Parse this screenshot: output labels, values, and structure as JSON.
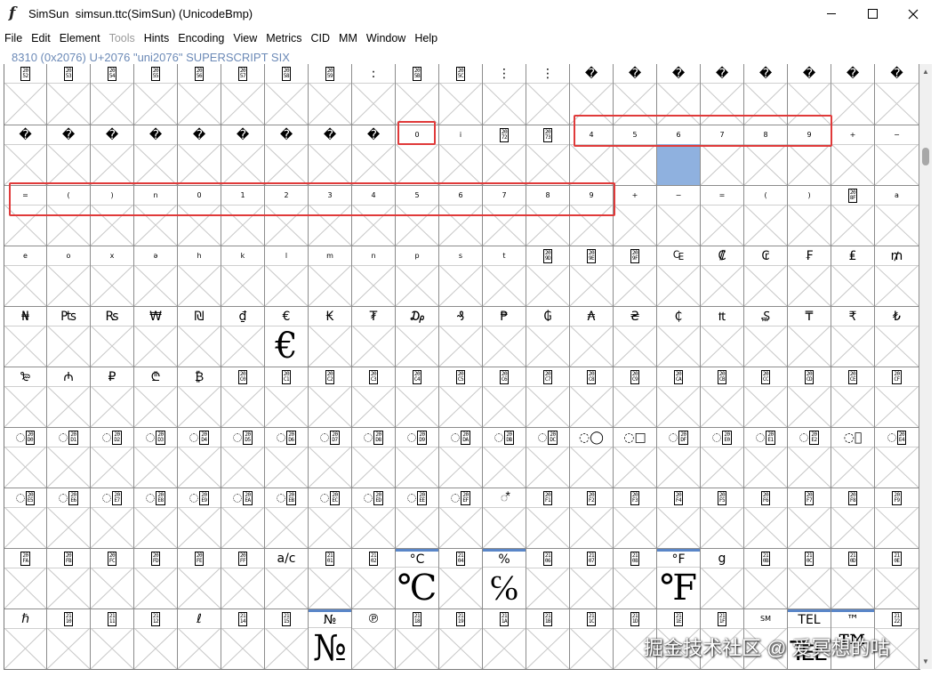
{
  "window": {
    "app_icon": "f",
    "title": "SimSun  simsun.ttc(SimSun) (UnicodeBmp)",
    "controls": [
      "minimize",
      "maximize",
      "close"
    ]
  },
  "menu": [
    "File",
    "Edit",
    "Element",
    "Tools",
    "Hints",
    "Encoding",
    "View",
    "Metrics",
    "CID",
    "MM",
    "Window",
    "Help"
  ],
  "menu_disabled": [
    "Tools"
  ],
  "info_line": "8310 (0x2076) U+2076 \"uni2076\" SUPERSCRIPT SIX",
  "watermark": "掘金技术社区 @ 爱冥想的咕",
  "rows": [
    [
      {
        "l": "hex:2052"
      },
      {
        "l": "hex:2053"
      },
      {
        "l": "hex:2054"
      },
      {
        "l": "hex:2055"
      },
      {
        "l": "hex:2056"
      },
      {
        "l": "hex:2057"
      },
      {
        "l": "hex:2058"
      },
      {
        "l": "hex:2059"
      },
      {
        "l": ":"
      },
      {
        "l": "hex:205B"
      },
      {
        "l": "hex:205C"
      },
      {
        "l": "⋮"
      },
      {
        "l": "⋮"
      },
      {
        "l": "�"
      },
      {
        "l": "�"
      },
      {
        "l": "�"
      },
      {
        "l": "�"
      },
      {
        "l": "�"
      },
      {
        "l": "�"
      },
      {
        "l": "�"
      },
      {
        "l": "�"
      }
    ],
    [
      {
        "l": "�"
      },
      {
        "l": "�"
      },
      {
        "l": "�"
      },
      {
        "l": "�"
      },
      {
        "l": "�"
      },
      {
        "l": "�"
      },
      {
        "l": "�"
      },
      {
        "l": "�"
      },
      {
        "l": "�"
      },
      {
        "l": "0",
        "t": 1
      },
      {
        "l": "i",
        "t": 1
      },
      {
        "l": "hex:2072"
      },
      {
        "l": "hex:2073"
      },
      {
        "l": "4",
        "t": 1
      },
      {
        "l": "5",
        "t": 1
      },
      {
        "l": "6",
        "t": 1,
        "sel": 1
      },
      {
        "l": "7",
        "t": 1
      },
      {
        "l": "8",
        "t": 1
      },
      {
        "l": "9",
        "t": 1
      },
      {
        "l": "+",
        "t": 1
      },
      {
        "l": "−",
        "t": 1
      }
    ],
    [
      {
        "l": "=",
        "t": 1
      },
      {
        "l": "(",
        "t": 1
      },
      {
        "l": ")",
        "t": 1
      },
      {
        "l": "n",
        "t": 1
      },
      {
        "l": "0",
        "t": 1
      },
      {
        "l": "1",
        "t": 1
      },
      {
        "l": "2",
        "t": 1
      },
      {
        "l": "3",
        "t": 1
      },
      {
        "l": "4",
        "t": 1
      },
      {
        "l": "5",
        "t": 1
      },
      {
        "l": "6",
        "t": 1
      },
      {
        "l": "7",
        "t": 1
      },
      {
        "l": "8",
        "t": 1
      },
      {
        "l": "9",
        "t": 1
      },
      {
        "l": "+",
        "t": 1
      },
      {
        "l": "−",
        "t": 1
      },
      {
        "l": "=",
        "t": 1
      },
      {
        "l": "(",
        "t": 1
      },
      {
        "l": ")",
        "t": 1
      },
      {
        "l": "hex:208F"
      },
      {
        "l": "a",
        "t": 1
      }
    ],
    [
      {
        "l": "e",
        "t": 1
      },
      {
        "l": "o",
        "t": 1
      },
      {
        "l": "x",
        "t": 1
      },
      {
        "l": "ə",
        "t": 1
      },
      {
        "l": "h",
        "t": 1
      },
      {
        "l": "k",
        "t": 1
      },
      {
        "l": "l",
        "t": 1
      },
      {
        "l": "m",
        "t": 1
      },
      {
        "l": "n",
        "t": 1
      },
      {
        "l": "p",
        "t": 1
      },
      {
        "l": "s",
        "t": 1
      },
      {
        "l": "t",
        "t": 1
      },
      {
        "l": "hex:209D"
      },
      {
        "l": "hex:209E"
      },
      {
        "l": "hex:209F"
      },
      {
        "l": "₠"
      },
      {
        "l": "₡"
      },
      {
        "l": "₢"
      },
      {
        "l": "₣"
      },
      {
        "l": "₤"
      },
      {
        "l": "₥"
      }
    ],
    [
      {
        "l": "₦"
      },
      {
        "l": "₧"
      },
      {
        "l": "₨"
      },
      {
        "l": "₩"
      },
      {
        "l": "₪"
      },
      {
        "l": "₫"
      },
      {
        "l": "€",
        "big": "€"
      },
      {
        "l": "₭"
      },
      {
        "l": "₮"
      },
      {
        "l": "₯"
      },
      {
        "l": "₰"
      },
      {
        "l": "₱"
      },
      {
        "l": "₲"
      },
      {
        "l": "₳"
      },
      {
        "l": "₴"
      },
      {
        "l": "₵"
      },
      {
        "l": "₶"
      },
      {
        "l": "₷"
      },
      {
        "l": "₸"
      },
      {
        "l": "₹"
      },
      {
        "l": "₺"
      }
    ],
    [
      {
        "l": "₻"
      },
      {
        "l": "₼"
      },
      {
        "l": "₽"
      },
      {
        "l": "₾"
      },
      {
        "l": "₿"
      },
      {
        "l": "hex:20C0"
      },
      {
        "l": "hex:20C1"
      },
      {
        "l": "hex:20C2"
      },
      {
        "l": "hex:20C3"
      },
      {
        "l": "hex:20C4"
      },
      {
        "l": "hex:20C5"
      },
      {
        "l": "hex:20C6"
      },
      {
        "l": "hex:20C7"
      },
      {
        "l": "hex:20C8"
      },
      {
        "l": "hex:20C9"
      },
      {
        "l": "hex:20CA"
      },
      {
        "l": "hex:20CB"
      },
      {
        "l": "hex:20CC"
      },
      {
        "l": "hex:20CD"
      },
      {
        "l": "hex:20CE"
      },
      {
        "l": "hex:20CF"
      }
    ],
    [
      {
        "l": "ring:20D0"
      },
      {
        "l": "ring:20D1"
      },
      {
        "l": "ring:20D2"
      },
      {
        "l": "ring:20D3"
      },
      {
        "l": "ring:20D4"
      },
      {
        "l": "ring:20D5"
      },
      {
        "l": "ring:20D6"
      },
      {
        "l": "ring:20D7"
      },
      {
        "l": "ring:20D8"
      },
      {
        "l": "ring:20D9"
      },
      {
        "l": "ring:20DA"
      },
      {
        "l": "ring:20DB"
      },
      {
        "l": "ring:20DC"
      },
      {
        "l": "◌◯"
      },
      {
        "l": "◌□"
      },
      {
        "l": "ring:20DF"
      },
      {
        "l": "ring:20E0"
      },
      {
        "l": "ring:20E1"
      },
      {
        "l": "ring:20E2"
      },
      {
        "l": "◌⃣"
      },
      {
        "l": "ring:20E4"
      }
    ],
    [
      {
        "l": "ring:20E5"
      },
      {
        "l": "ring:20E6"
      },
      {
        "l": "ring:20E7"
      },
      {
        "l": "ring:20E8"
      },
      {
        "l": "ring:20E9"
      },
      {
        "l": "ring:20EA"
      },
      {
        "l": "ring:20EB"
      },
      {
        "l": "ring:20EC"
      },
      {
        "l": "ring:20ED"
      },
      {
        "l": "ring:20EE"
      },
      {
        "l": "ring:20EF"
      },
      {
        "l": "◌⃰"
      },
      {
        "l": "hex:20F1"
      },
      {
        "l": "hex:20F2"
      },
      {
        "l": "hex:20F3"
      },
      {
        "l": "hex:20F4"
      },
      {
        "l": "hex:20F5"
      },
      {
        "l": "hex:20F6"
      },
      {
        "l": "hex:20F7"
      },
      {
        "l": "hex:20F8"
      },
      {
        "l": "hex:20F9"
      }
    ],
    [
      {
        "l": "hex:20FA"
      },
      {
        "l": "hex:20FB"
      },
      {
        "l": "hex:20FC"
      },
      {
        "l": "hex:20FD"
      },
      {
        "l": "hex:20FE"
      },
      {
        "l": "hex:20FF"
      },
      {
        "l": "a/c"
      },
      {
        "l": "hex:2101"
      },
      {
        "l": "hex:2102"
      },
      {
        "l": "°C",
        "big": "℃",
        "m": 1
      },
      {
        "l": "hex:2104"
      },
      {
        "l": "%",
        "big": "℅",
        "m": 1
      },
      {
        "l": "hex:2106"
      },
      {
        "l": "hex:2107"
      },
      {
        "l": "hex:2108"
      },
      {
        "l": "°F",
        "big": "℉",
        "m": 1
      },
      {
        "l": "g"
      },
      {
        "l": "hex:210B"
      },
      {
        "l": "hex:210C"
      },
      {
        "l": "hex:210D"
      },
      {
        "l": "hex:210E"
      }
    ],
    [
      {
        "l": "ℏ"
      },
      {
        "l": "hex:2110"
      },
      {
        "l": "hex:2111"
      },
      {
        "l": "hex:2112"
      },
      {
        "l": "ℓ"
      },
      {
        "l": "hex:2114"
      },
      {
        "l": "hex:2115"
      },
      {
        "l": "№",
        "big": "№",
        "m": 1
      },
      {
        "l": "℗"
      },
      {
        "l": "hex:2118"
      },
      {
        "l": "hex:2119"
      },
      {
        "l": "hex:211A"
      },
      {
        "l": "hex:211B"
      },
      {
        "l": "hex:211C"
      },
      {
        "l": "hex:211D"
      },
      {
        "l": "hex:211E"
      },
      {
        "l": "hex:211F"
      },
      {
        "l": "SM",
        "t": 1
      },
      {
        "l": "TEL",
        "big": "℡",
        "m": 1
      },
      {
        "l": "™",
        "big": "™",
        "m": 1
      },
      {
        "l": "hex:2122"
      }
    ]
  ]
}
